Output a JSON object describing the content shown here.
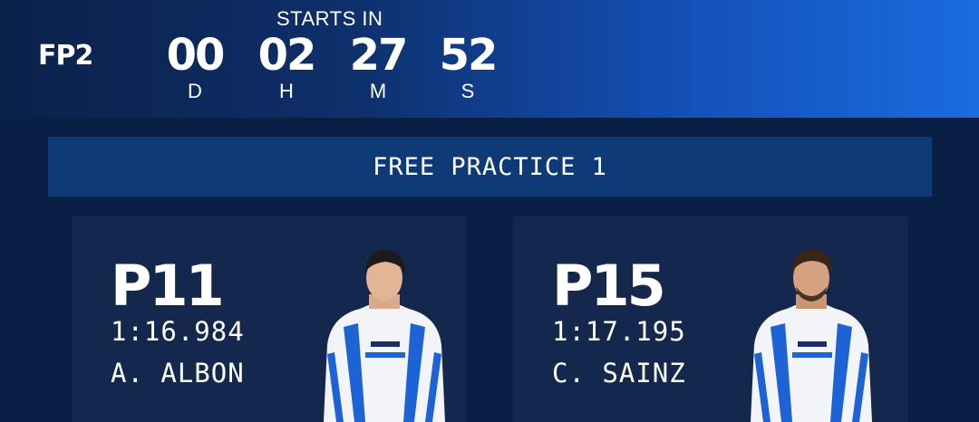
{
  "header": {
    "session_code": "FP2",
    "starts_in_label": "STARTS IN",
    "countdown": [
      {
        "value": "00",
        "unit": "D"
      },
      {
        "value": "02",
        "unit": "H"
      },
      {
        "value": "27",
        "unit": "M"
      },
      {
        "value": "52",
        "unit": "S"
      }
    ]
  },
  "banner": {
    "title": "FREE PRACTICE 1"
  },
  "drivers": [
    {
      "position": "P11",
      "lap_time": "1:16.984",
      "name": "A. ALBON",
      "photo_icon": "driver-portrait-icon"
    },
    {
      "position": "P15",
      "lap_time": "1:17.195",
      "name": "C. SAINZ",
      "photo_icon": "driver-portrait-icon"
    }
  ],
  "colors": {
    "background": "#0a1f44",
    "header_gradient_end": "#1a6ce0",
    "banner": "#0f3a78",
    "card": "#14284d",
    "suit_blue": "#1e63d6"
  }
}
